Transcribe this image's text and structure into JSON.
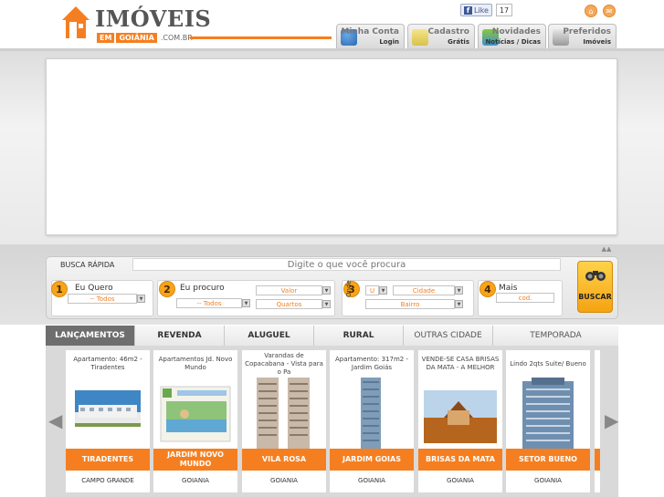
{
  "logo": {
    "title": "IMÓVEIS",
    "em": "EM",
    "city": "GOIÂNIA",
    "domain": ".COM.BR"
  },
  "facebook": {
    "like_label": "Like",
    "count": "17"
  },
  "top_tabs": [
    {
      "line1": "Minha Conta",
      "line2": "Login"
    },
    {
      "line1": "Cadastro",
      "line2": "Grátis"
    },
    {
      "line1": "Novidades",
      "line2": "Notícias / Dicas"
    },
    {
      "line1": "Preferidos",
      "line2": "Imóveis"
    }
  ],
  "search": {
    "label": "BUSCA RÁPIDA",
    "placeholder": "Digite o que você procura",
    "step1": {
      "num": "1",
      "label": "Eu Quero",
      "select": "-- Todos"
    },
    "step2": {
      "num": "2",
      "label": "Eu procuro",
      "select_type": "-- Todos",
      "valor": "Valor",
      "quartos": "Quartos"
    },
    "step3": {
      "num": "3",
      "vertical_label": "Onde",
      "uf": "U",
      "cidade": "Cidade",
      "bairro": "Bairro"
    },
    "step4": {
      "num": "4",
      "label": "Mais",
      "cod": "cod."
    },
    "button_label": "BUSCAR"
  },
  "listing_tabs": [
    "LANÇAMENTOS",
    "REVENDA",
    "ALUGUEL",
    "RURAL",
    "OUTRAS CIDADE",
    "TEMPORADA"
  ],
  "listings": [
    {
      "title": "Apartamento: 46m2 - Tiradentes",
      "name": "TIRADENTES",
      "city": "CAMPO GRANDE"
    },
    {
      "title": "Apartamentos Jd. Novo Mundo",
      "name": "JARDIM NOVO MUNDO",
      "city": "GOIANIA"
    },
    {
      "title": "Varandas de Copacabana - Vista para o Pa",
      "name": "VILA ROSA",
      "city": "GOIANIA"
    },
    {
      "title": "Apartamento: 317m2 - Jardim Goiás",
      "name": "JARDIM GOIAS",
      "city": "GOIANIA"
    },
    {
      "title": "VENDE-SE CASA BRISAS DA MATA - A MELHOR",
      "name": "BRISAS DA MATA",
      "city": "GOIANIA"
    },
    {
      "title": "Lindo 2qts Suite/ Bueno",
      "name": "SETOR BUENO",
      "city": "GOIANIA"
    }
  ],
  "colors": {
    "accent": "#f57f20",
    "tab_active": "#6e6e6e"
  }
}
